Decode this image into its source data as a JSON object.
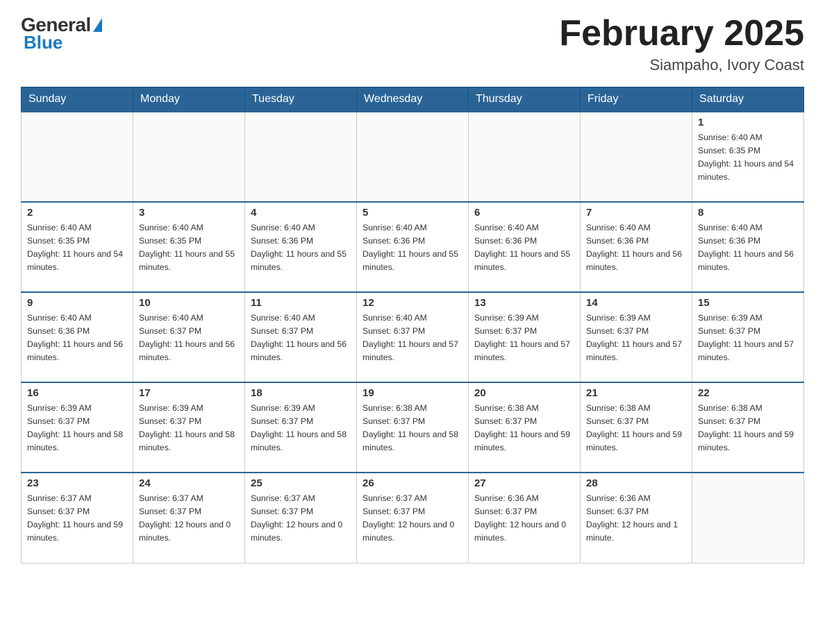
{
  "header": {
    "logo_general": "General",
    "logo_blue": "Blue",
    "title": "February 2025",
    "location": "Siampaho, Ivory Coast"
  },
  "weekdays": [
    "Sunday",
    "Monday",
    "Tuesday",
    "Wednesday",
    "Thursday",
    "Friday",
    "Saturday"
  ],
  "weeks": [
    [
      {
        "day": "",
        "sunrise": "",
        "sunset": "",
        "daylight": ""
      },
      {
        "day": "",
        "sunrise": "",
        "sunset": "",
        "daylight": ""
      },
      {
        "day": "",
        "sunrise": "",
        "sunset": "",
        "daylight": ""
      },
      {
        "day": "",
        "sunrise": "",
        "sunset": "",
        "daylight": ""
      },
      {
        "day": "",
        "sunrise": "",
        "sunset": "",
        "daylight": ""
      },
      {
        "day": "",
        "sunrise": "",
        "sunset": "",
        "daylight": ""
      },
      {
        "day": "1",
        "sunrise": "Sunrise: 6:40 AM",
        "sunset": "Sunset: 6:35 PM",
        "daylight": "Daylight: 11 hours and 54 minutes."
      }
    ],
    [
      {
        "day": "2",
        "sunrise": "Sunrise: 6:40 AM",
        "sunset": "Sunset: 6:35 PM",
        "daylight": "Daylight: 11 hours and 54 minutes."
      },
      {
        "day": "3",
        "sunrise": "Sunrise: 6:40 AM",
        "sunset": "Sunset: 6:35 PM",
        "daylight": "Daylight: 11 hours and 55 minutes."
      },
      {
        "day": "4",
        "sunrise": "Sunrise: 6:40 AM",
        "sunset": "Sunset: 6:36 PM",
        "daylight": "Daylight: 11 hours and 55 minutes."
      },
      {
        "day": "5",
        "sunrise": "Sunrise: 6:40 AM",
        "sunset": "Sunset: 6:36 PM",
        "daylight": "Daylight: 11 hours and 55 minutes."
      },
      {
        "day": "6",
        "sunrise": "Sunrise: 6:40 AM",
        "sunset": "Sunset: 6:36 PM",
        "daylight": "Daylight: 11 hours and 55 minutes."
      },
      {
        "day": "7",
        "sunrise": "Sunrise: 6:40 AM",
        "sunset": "Sunset: 6:36 PM",
        "daylight": "Daylight: 11 hours and 56 minutes."
      },
      {
        "day": "8",
        "sunrise": "Sunrise: 6:40 AM",
        "sunset": "Sunset: 6:36 PM",
        "daylight": "Daylight: 11 hours and 56 minutes."
      }
    ],
    [
      {
        "day": "9",
        "sunrise": "Sunrise: 6:40 AM",
        "sunset": "Sunset: 6:36 PM",
        "daylight": "Daylight: 11 hours and 56 minutes."
      },
      {
        "day": "10",
        "sunrise": "Sunrise: 6:40 AM",
        "sunset": "Sunset: 6:37 PM",
        "daylight": "Daylight: 11 hours and 56 minutes."
      },
      {
        "day": "11",
        "sunrise": "Sunrise: 6:40 AM",
        "sunset": "Sunset: 6:37 PM",
        "daylight": "Daylight: 11 hours and 56 minutes."
      },
      {
        "day": "12",
        "sunrise": "Sunrise: 6:40 AM",
        "sunset": "Sunset: 6:37 PM",
        "daylight": "Daylight: 11 hours and 57 minutes."
      },
      {
        "day": "13",
        "sunrise": "Sunrise: 6:39 AM",
        "sunset": "Sunset: 6:37 PM",
        "daylight": "Daylight: 11 hours and 57 minutes."
      },
      {
        "day": "14",
        "sunrise": "Sunrise: 6:39 AM",
        "sunset": "Sunset: 6:37 PM",
        "daylight": "Daylight: 11 hours and 57 minutes."
      },
      {
        "day": "15",
        "sunrise": "Sunrise: 6:39 AM",
        "sunset": "Sunset: 6:37 PM",
        "daylight": "Daylight: 11 hours and 57 minutes."
      }
    ],
    [
      {
        "day": "16",
        "sunrise": "Sunrise: 6:39 AM",
        "sunset": "Sunset: 6:37 PM",
        "daylight": "Daylight: 11 hours and 58 minutes."
      },
      {
        "day": "17",
        "sunrise": "Sunrise: 6:39 AM",
        "sunset": "Sunset: 6:37 PM",
        "daylight": "Daylight: 11 hours and 58 minutes."
      },
      {
        "day": "18",
        "sunrise": "Sunrise: 6:39 AM",
        "sunset": "Sunset: 6:37 PM",
        "daylight": "Daylight: 11 hours and 58 minutes."
      },
      {
        "day": "19",
        "sunrise": "Sunrise: 6:38 AM",
        "sunset": "Sunset: 6:37 PM",
        "daylight": "Daylight: 11 hours and 58 minutes."
      },
      {
        "day": "20",
        "sunrise": "Sunrise: 6:38 AM",
        "sunset": "Sunset: 6:37 PM",
        "daylight": "Daylight: 11 hours and 59 minutes."
      },
      {
        "day": "21",
        "sunrise": "Sunrise: 6:38 AM",
        "sunset": "Sunset: 6:37 PM",
        "daylight": "Daylight: 11 hours and 59 minutes."
      },
      {
        "day": "22",
        "sunrise": "Sunrise: 6:38 AM",
        "sunset": "Sunset: 6:37 PM",
        "daylight": "Daylight: 11 hours and 59 minutes."
      }
    ],
    [
      {
        "day": "23",
        "sunrise": "Sunrise: 6:37 AM",
        "sunset": "Sunset: 6:37 PM",
        "daylight": "Daylight: 11 hours and 59 minutes."
      },
      {
        "day": "24",
        "sunrise": "Sunrise: 6:37 AM",
        "sunset": "Sunset: 6:37 PM",
        "daylight": "Daylight: 12 hours and 0 minutes."
      },
      {
        "day": "25",
        "sunrise": "Sunrise: 6:37 AM",
        "sunset": "Sunset: 6:37 PM",
        "daylight": "Daylight: 12 hours and 0 minutes."
      },
      {
        "day": "26",
        "sunrise": "Sunrise: 6:37 AM",
        "sunset": "Sunset: 6:37 PM",
        "daylight": "Daylight: 12 hours and 0 minutes."
      },
      {
        "day": "27",
        "sunrise": "Sunrise: 6:36 AM",
        "sunset": "Sunset: 6:37 PM",
        "daylight": "Daylight: 12 hours and 0 minutes."
      },
      {
        "day": "28",
        "sunrise": "Sunrise: 6:36 AM",
        "sunset": "Sunset: 6:37 PM",
        "daylight": "Daylight: 12 hours and 1 minute."
      },
      {
        "day": "",
        "sunrise": "",
        "sunset": "",
        "daylight": ""
      }
    ]
  ]
}
